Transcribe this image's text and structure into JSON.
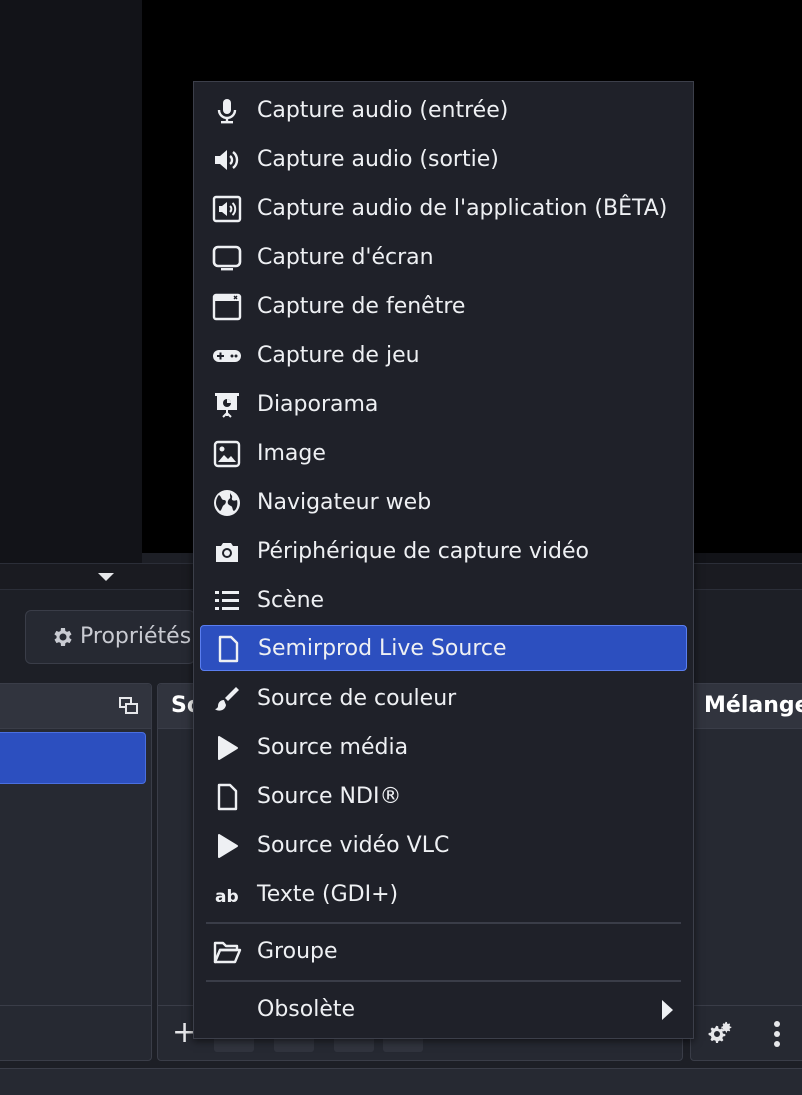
{
  "properties_button": {
    "label": "Propriétés"
  },
  "docks": {
    "scenes": {
      "title": ""
    },
    "sources": {
      "title": "So"
    },
    "mixer": {
      "title": "Mélange"
    }
  },
  "menu": {
    "items": [
      {
        "label": "Capture audio (entrée)",
        "icon": "microphone-icon"
      },
      {
        "label": "Capture audio (sortie)",
        "icon": "speaker-icon"
      },
      {
        "label": "Capture audio de l'application (BÊTA)",
        "icon": "app-audio-icon"
      },
      {
        "label": "Capture d'écran",
        "icon": "monitor-icon"
      },
      {
        "label": "Capture de fenêtre",
        "icon": "window-icon"
      },
      {
        "label": "Capture de jeu",
        "icon": "gamepad-icon"
      },
      {
        "label": "Diaporama",
        "icon": "slideshow-icon"
      },
      {
        "label": "Image",
        "icon": "image-icon"
      },
      {
        "label": "Navigateur web",
        "icon": "globe-icon"
      },
      {
        "label": "Périphérique de capture vidéo",
        "icon": "camera-icon"
      },
      {
        "label": "Scène",
        "icon": "list-icon"
      },
      {
        "label": "Semirprod Live Source",
        "icon": "file-icon",
        "selected": true
      },
      {
        "label": "Source de couleur",
        "icon": "brush-icon"
      },
      {
        "label": "Source média",
        "icon": "play-icon"
      },
      {
        "label": "Source NDI®",
        "icon": "file-icon"
      },
      {
        "label": "Source vidéo VLC",
        "icon": "play-icon"
      },
      {
        "label": "Texte (GDI+)",
        "icon": "text-icon"
      }
    ],
    "group": {
      "label": "Groupe",
      "icon": "folder-open-icon"
    },
    "deprecated": {
      "label": "Obsolète",
      "icon": "chevron-right-icon"
    }
  },
  "colors": {
    "accent": "#2c4fbf",
    "menu_bg": "#1f2129",
    "text": "#eef0f3"
  }
}
